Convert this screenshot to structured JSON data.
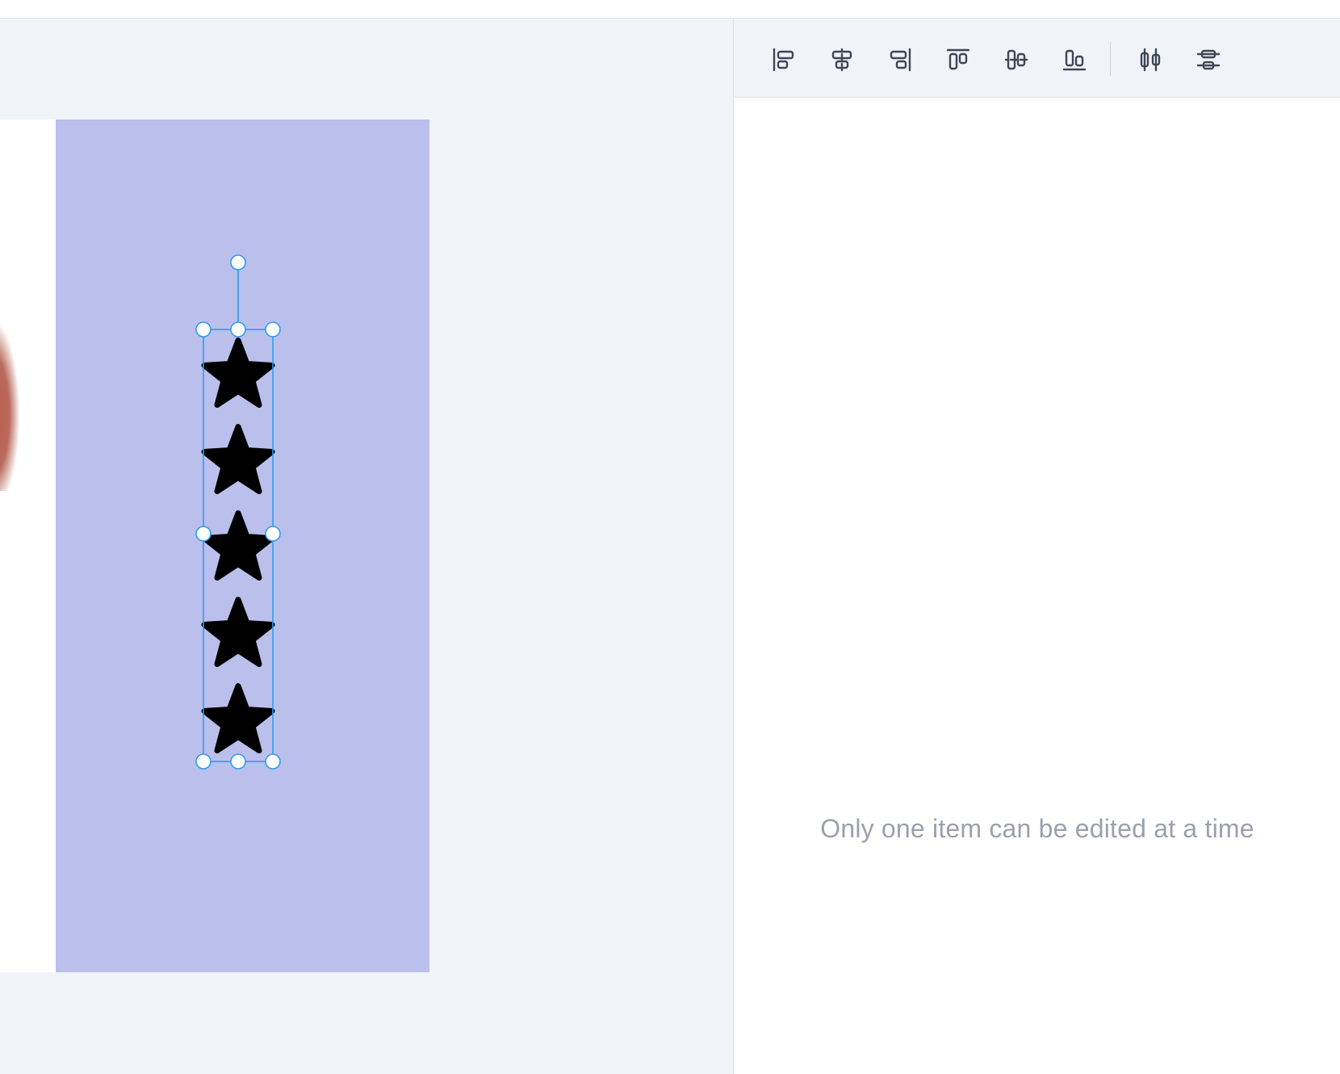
{
  "colors": {
    "workspace_bg": "#f0f3f8",
    "page_bg": "#bbbfec",
    "selection": "#2f9bf0",
    "star_fill": "#000000",
    "toolbar_icon": "#3d4654",
    "message_text": "#9aa1ac"
  },
  "canvas": {
    "page_background_color": "#bbbfec",
    "stars": {
      "icon": "star-icon",
      "count": 5,
      "fill": "#000000"
    },
    "selection": {
      "handles": [
        "rotate",
        "top-left",
        "top-center",
        "top-right",
        "middle-left",
        "middle-right",
        "bottom-left",
        "bottom-center",
        "bottom-right"
      ]
    }
  },
  "align_toolbar": {
    "tools": [
      {
        "name": "align-left",
        "icon": "align-left-icon"
      },
      {
        "name": "align-center-horizontal",
        "icon": "align-center-horizontal-icon"
      },
      {
        "name": "align-right",
        "icon": "align-right-icon"
      },
      {
        "name": "align-top",
        "icon": "align-top-icon"
      },
      {
        "name": "align-middle-vertical",
        "icon": "align-middle-vertical-icon"
      },
      {
        "name": "align-bottom",
        "icon": "align-bottom-icon"
      },
      {
        "name": "distribute-horizontal",
        "icon": "distribute-horizontal-icon"
      },
      {
        "name": "distribute-vertical",
        "icon": "distribute-vertical-icon"
      }
    ]
  },
  "panel": {
    "message": "Only one item can be edited at a time"
  }
}
